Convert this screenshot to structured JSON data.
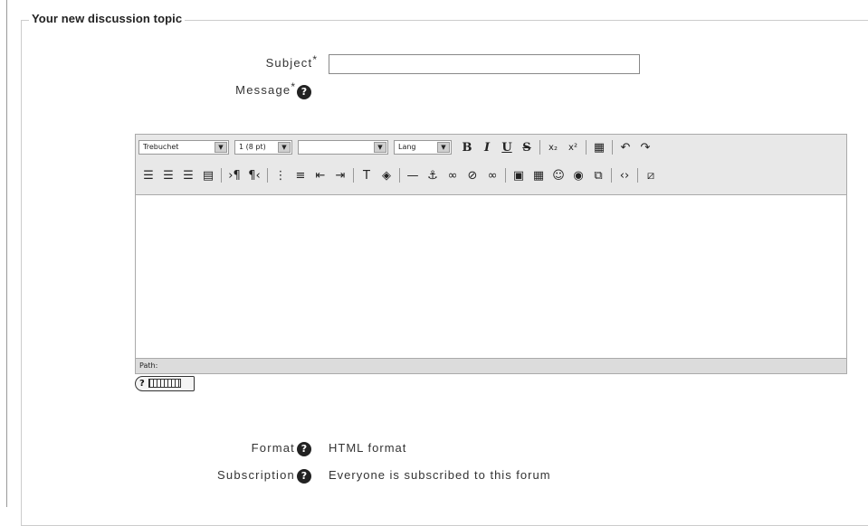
{
  "fieldset": {
    "legend": "Your new discussion topic"
  },
  "subject": {
    "label": "Subject",
    "required_mark": "*",
    "value": ""
  },
  "message": {
    "label": "Message",
    "required_mark": "*",
    "help": "?"
  },
  "editor": {
    "font_select": "Trebuchet",
    "size_select": "1 (8 pt)",
    "style_select": "",
    "lang_select": "Lang",
    "bold": "B",
    "italic": "I",
    "underline": "U",
    "strikethrough": "S",
    "subscript": "x₂",
    "superscript": "x²",
    "path_label": "Path:"
  },
  "keyboard_help": {
    "label": "?"
  },
  "format": {
    "label": "Format",
    "help": "?",
    "value": "HTML format"
  },
  "subscription": {
    "label": "Subscription",
    "help": "?",
    "value": "Everyone is subscribed to this forum"
  }
}
